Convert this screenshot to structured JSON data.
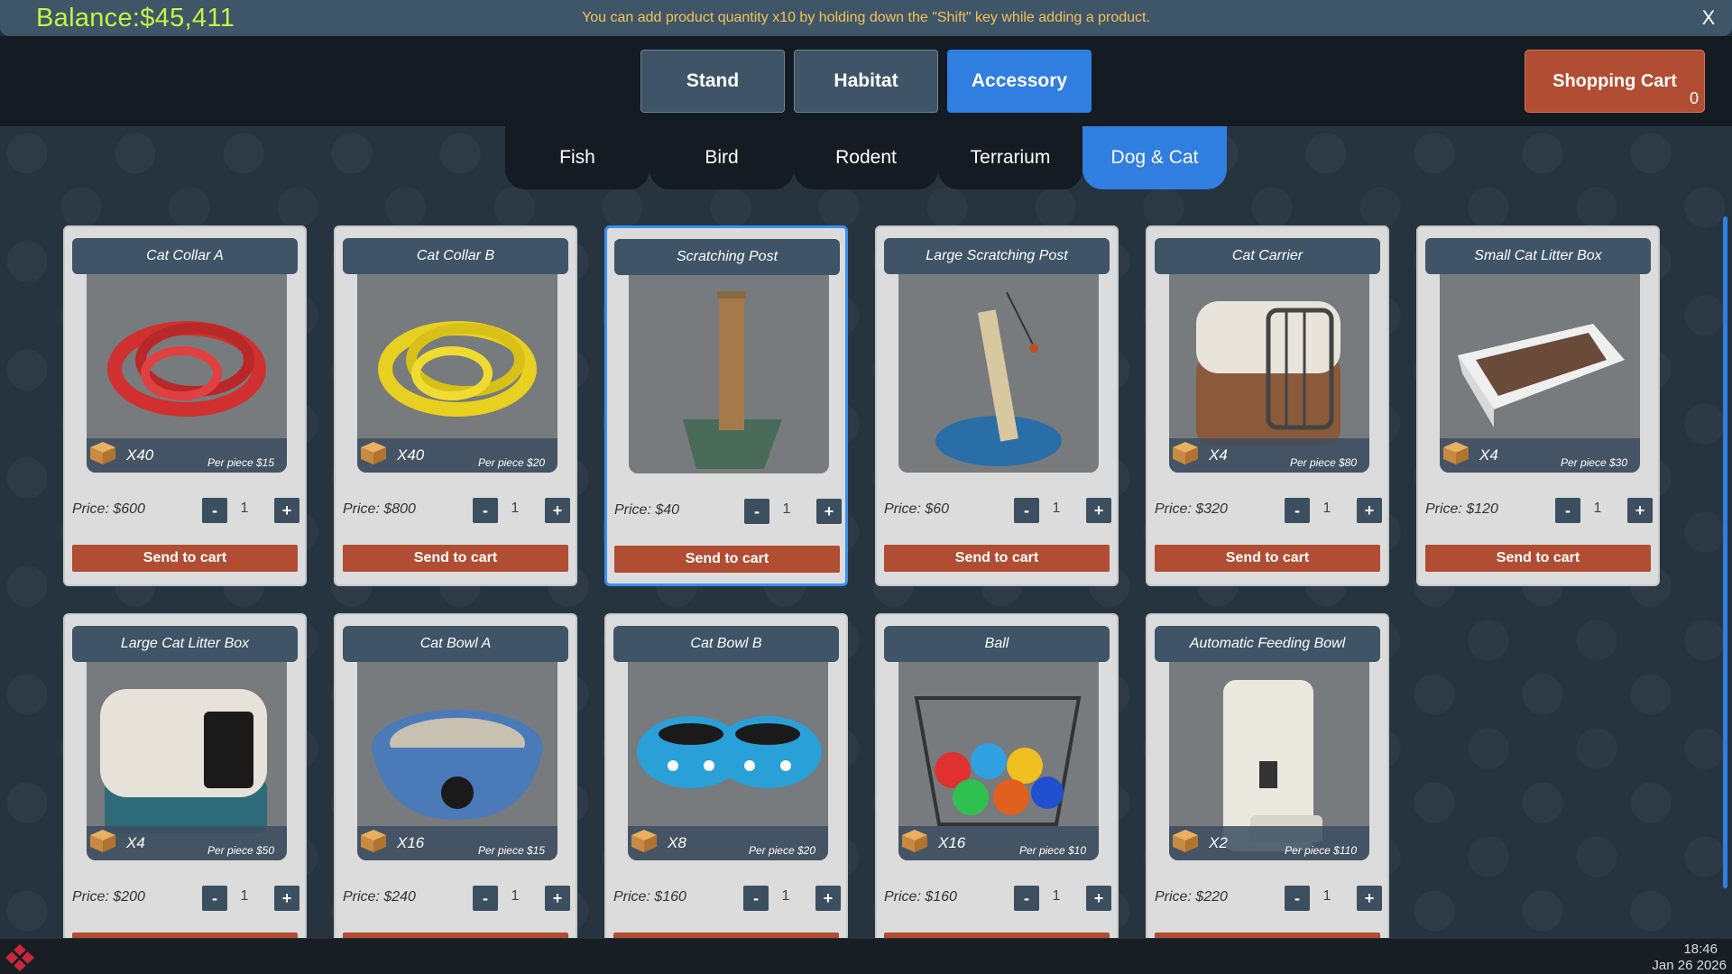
{
  "balance": "Balance:$45,411",
  "hint": "You can add product quantity x10 by holding down the \"Shift\" key while adding a product.",
  "close_label": "X",
  "main_tabs": [
    {
      "label": "Stand",
      "active": false
    },
    {
      "label": "Habitat",
      "active": false
    },
    {
      "label": "Accessory",
      "active": true
    }
  ],
  "cart": {
    "label": "Shopping Cart",
    "count": "0"
  },
  "sub_tabs": [
    {
      "label": "Fish",
      "active": false
    },
    {
      "label": "Bird",
      "active": false
    },
    {
      "label": "Rodent",
      "active": false
    },
    {
      "label": "Terrarium",
      "active": false
    },
    {
      "label": "Dog & Cat",
      "active": true
    }
  ],
  "products": [
    {
      "name": "Cat Collar A",
      "pack": "X40",
      "per_piece": "Per piece  $15",
      "price": "Price: $600",
      "qty": "1",
      "icon": "collar-red-icon",
      "selected": false
    },
    {
      "name": "Cat Collar B",
      "pack": "X40",
      "per_piece": "Per piece  $20",
      "price": "Price: $800",
      "qty": "1",
      "icon": "collar-yellow-icon",
      "selected": false
    },
    {
      "name": "Scratching Post",
      "pack": "",
      "per_piece": "",
      "price": "Price: $40",
      "qty": "1",
      "icon": "scratching-post-icon",
      "selected": true
    },
    {
      "name": "Large Scratching Post",
      "pack": "",
      "per_piece": "",
      "price": "Price: $60",
      "qty": "1",
      "icon": "large-scratching-post-icon",
      "selected": false
    },
    {
      "name": "Cat Carrier",
      "pack": "X4",
      "per_piece": "Per piece  $80",
      "price": "Price: $320",
      "qty": "1",
      "icon": "cat-carrier-icon",
      "selected": false
    },
    {
      "name": "Small Cat Litter Box",
      "pack": "X4",
      "per_piece": "Per piece  $30",
      "price": "Price: $120",
      "qty": "1",
      "icon": "litter-box-small-icon",
      "selected": false
    },
    {
      "name": "Large Cat Litter Box",
      "pack": "X4",
      "per_piece": "Per piece  $50",
      "price": "Price: $200",
      "qty": "1",
      "icon": "litter-box-large-icon",
      "selected": false
    },
    {
      "name": "Cat Bowl A",
      "pack": "X16",
      "per_piece": "Per piece  $15",
      "price": "Price: $240",
      "qty": "1",
      "icon": "cat-bowl-a-icon",
      "selected": false
    },
    {
      "name": "Cat Bowl B",
      "pack": "X8",
      "per_piece": "Per piece  $20",
      "price": "Price: $160",
      "qty": "1",
      "icon": "cat-bowl-b-icon",
      "selected": false
    },
    {
      "name": "Ball",
      "pack": "X16",
      "per_piece": "Per piece  $10",
      "price": "Price: $160",
      "qty": "1",
      "icon": "ball-basket-icon",
      "selected": false
    },
    {
      "name": "Automatic Feeding Bowl",
      "pack": "X2",
      "per_piece": "Per piece  $110",
      "price": "Price: $220",
      "qty": "1",
      "icon": "auto-feeder-icon",
      "selected": false
    }
  ],
  "stepper": {
    "minus": "-",
    "plus": "+"
  },
  "send_label": "Send to cart",
  "taskbar": {
    "time": "18:46",
    "date": "Jan 26 2026"
  },
  "colors": {
    "accent": "#2f7ee0",
    "cart": "#b14d33",
    "balance": "#c8f046",
    "hint": "#f4c15a"
  }
}
